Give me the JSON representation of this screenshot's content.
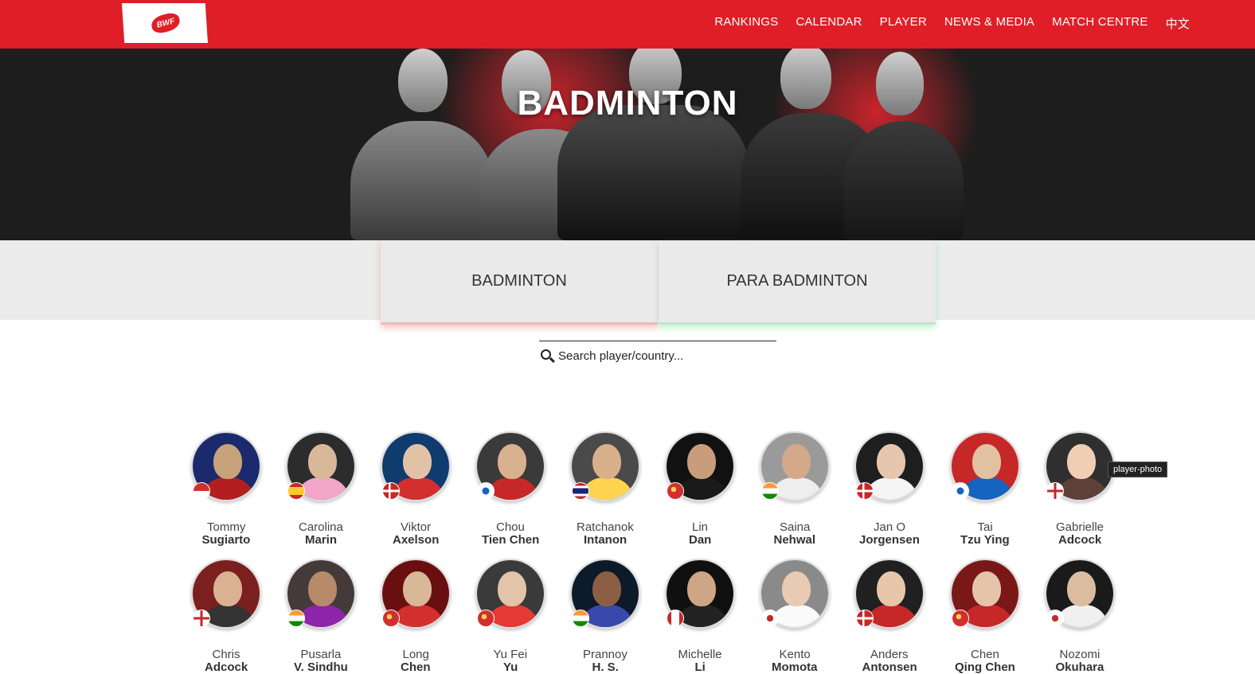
{
  "header": {
    "logo_text": "BWF",
    "nav": [
      "RANKINGS",
      "CALENDAR",
      "PLAYER",
      "NEWS & MEDIA",
      "MATCH CENTRE",
      "中文"
    ]
  },
  "hero": {
    "title": "BADMINTON"
  },
  "tabs": [
    {
      "label": "BADMINTON",
      "accent": "#f07a7a"
    },
    {
      "label": "PARA BADMINTON",
      "accent": "#78e6a0"
    }
  ],
  "search": {
    "placeholder": "Search player/country..."
  },
  "tooltip": "player-photo",
  "players": [
    {
      "first": "Tommy",
      "last": "Sugiarto",
      "flag": "indonesia-flag-icon"
    },
    {
      "first": "Carolina",
      "last": "Marin",
      "flag": "spain-flag-icon"
    },
    {
      "first": "Viktor",
      "last": "Axelson",
      "flag": "denmark-flag-icon"
    },
    {
      "first": "Chou",
      "last": "Tien Chen",
      "flag": "chinese-taipei-flag-icon"
    },
    {
      "first": "Ratchanok",
      "last": "Intanon",
      "flag": "thailand-flag-icon"
    },
    {
      "first": "Lin",
      "last": "Dan",
      "flag": "china-flag-icon"
    },
    {
      "first": "Saina",
      "last": "Nehwal",
      "flag": "india-flag-icon"
    },
    {
      "first": "Jan O",
      "last": "Jorgensen",
      "flag": "denmark-flag-icon"
    },
    {
      "first": "Tai",
      "last": "Tzu Ying",
      "flag": "chinese-taipei-flag-icon"
    },
    {
      "first": "Gabrielle",
      "last": "Adcock",
      "flag": "england-flag-icon"
    },
    {
      "first": "Chris",
      "last": "Adcock",
      "flag": "england-flag-icon"
    },
    {
      "first": "Pusarla",
      "last": "V. Sindhu",
      "flag": "india-flag-icon"
    },
    {
      "first": "Long",
      "last": "Chen",
      "flag": "china-flag-icon"
    },
    {
      "first": "Yu Fei",
      "last": "Yu",
      "flag": "china-flag-icon"
    },
    {
      "first": "Prannoy",
      "last": "H. S.",
      "flag": "india-flag-icon"
    },
    {
      "first": "Michelle",
      "last": "Li",
      "flag": "canada-flag-icon"
    },
    {
      "first": "Kento",
      "last": "Momota",
      "flag": "japan-flag-icon"
    },
    {
      "first": "Anders",
      "last": "Antonsen",
      "flag": "denmark-flag-icon"
    },
    {
      "first": "Chen",
      "last": "Qing Chen",
      "flag": "china-flag-icon"
    },
    {
      "first": "Nozomi",
      "last": "Okuhara",
      "flag": "japan-flag-icon"
    }
  ],
  "colors": {
    "brand_red": "#e01e27",
    "tab_bg": "#eaeaea"
  }
}
